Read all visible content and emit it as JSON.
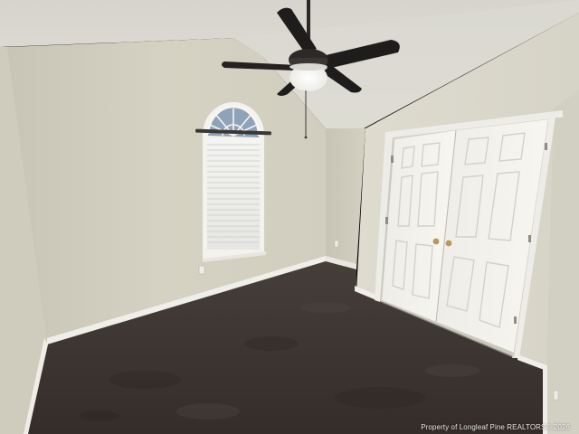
{
  "photo": {
    "watermark": "Property of Longleaf Pine REALTORS® 2026"
  },
  "colors": {
    "wall": "#d8d4c6",
    "ceiling": "#dad8d1",
    "carpet": "#3d3531",
    "trim": "#f2f0ea",
    "door": "#f5f4ef",
    "fan_blade": "#1e1c1b"
  },
  "icons": {
    "ceiling_fan": "ceiling-fan-icon",
    "window": "arched-window-icon",
    "closet": "double-door-closet-icon"
  }
}
